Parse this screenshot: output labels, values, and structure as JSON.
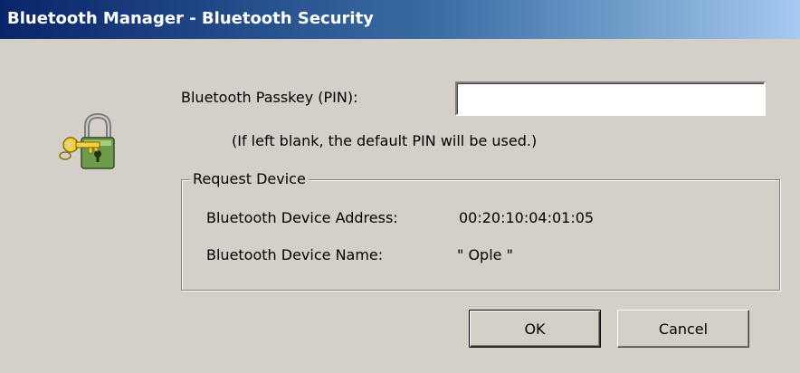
{
  "window": {
    "title": "Bluetooth Manager - Bluetooth Security"
  },
  "pin": {
    "label": "Bluetooth Passkey (PIN):",
    "value": "",
    "hint": "(If left blank, the default PIN will be used.)"
  },
  "icon": "padlock-with-key-icon",
  "request_device": {
    "legend": "Request Device",
    "address_label": "Bluetooth Device Address:",
    "address_value": "00:20:10:04:01:05",
    "name_label": "Bluetooth Device Name:",
    "name_value": "\" Ople \""
  },
  "buttons": {
    "ok_label": "OK",
    "cancel_label": "Cancel"
  },
  "colors": {
    "dialog_bg": "#d4d0c8",
    "titlebar_start": "#0a246a",
    "titlebar_end": "#a6caf0"
  }
}
